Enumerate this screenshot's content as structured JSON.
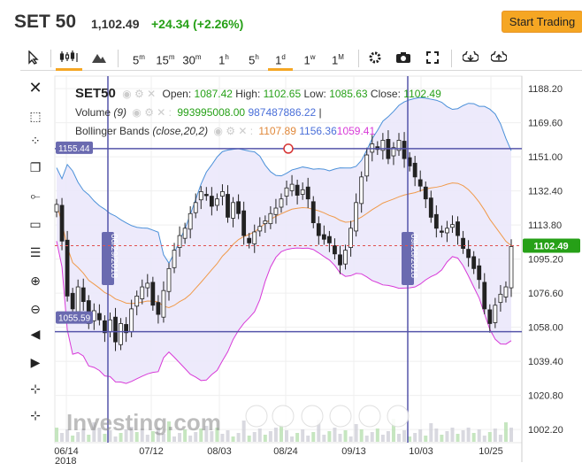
{
  "header": {
    "symbol": "SET 50",
    "price": "1,102.49",
    "change": "+24.34 (+2.26%)",
    "start_trading": "Start Trading"
  },
  "toolbar": {
    "timeframes": [
      "5m",
      "15m",
      "30m",
      "1h",
      "5h",
      "1d",
      "1w",
      "1M"
    ],
    "active_timeframe": "1d",
    "icons": [
      "cursor-icon",
      "candles-icon",
      "mountain-icon",
      "gear-icon",
      "camera-icon",
      "fullscreen-icon",
      "download-icon",
      "upload-icon"
    ]
  },
  "left_tools": [
    "close-icon",
    "zoom-select-icon",
    "crosshair-icon",
    "clone-icon",
    "trendline-icon",
    "rectangle-icon",
    "fib-icon",
    "zoom-in-icon",
    "zoom-out-icon",
    "scroll-left-icon",
    "scroll-right-icon",
    "magnet-plus-icon",
    "magnet-minus-icon"
  ],
  "info": {
    "symbol": "SET50",
    "open_label": "Open:",
    "open": "1087.42",
    "high_label": "High:",
    "high": "1102.65",
    "low_label": "Low:",
    "low": "1085.63",
    "close_label": "Close:",
    "close": "1102.49",
    "volume_label": "Volume",
    "volume_param": "(9)",
    "volume_values": "993995008.00",
    "volume_ma": "987487886.22",
    "bb_label": "Bollinger Bands",
    "bb_params": "(close,20,2)",
    "bb_mid": "1107.89",
    "bb_upper": "1156.36",
    "bb_lower": "1059.41"
  },
  "colors": {
    "up": "#26a017",
    "down": "#d63333",
    "accent": "#f5a623",
    "band_upper": "#4a90d9",
    "band_lower": "#d83ad8",
    "band_mid": "#f09a4a",
    "band_fill": "#ebe8fb",
    "hline": "#5555aa",
    "price_tag": "#26a017"
  },
  "chart_data": {
    "type": "candlestick",
    "price_axis_ticks": [
      "1188.20",
      "1169.60",
      "1151.00",
      "1132.40",
      "1113.80",
      "1095.20",
      "1076.60",
      "1058.00",
      "1039.40",
      "1020.80",
      "1002.20"
    ],
    "ylim": [
      995,
      1195
    ],
    "x_ticks": [
      "06/14",
      "07/12",
      "08/03",
      "08/24",
      "09/13",
      "10/03",
      "10/25"
    ],
    "x_year": "2018",
    "current_price_tag": "1102.49",
    "hline_labels": [
      "1155.44",
      "1055.59"
    ],
    "vline_labels": [
      "06/29/2018",
      "09/28/2018"
    ],
    "watermark": "Investing.com",
    "closes": [
      1125,
      1105,
      1075,
      1068,
      1080,
      1072,
      1060,
      1067,
      1062,
      1055,
      1062,
      1050,
      1060,
      1055,
      1068,
      1075,
      1080,
      1082,
      1070,
      1065,
      1078,
      1090,
      1100,
      1108,
      1112,
      1120,
      1126,
      1132,
      1130,
      1124,
      1128,
      1132,
      1118,
      1126,
      1120,
      1108,
      1104,
      1110,
      1113,
      1116,
      1120,
      1123,
      1128,
      1134,
      1136,
      1130,
      1133,
      1128,
      1115,
      1108,
      1106,
      1104,
      1098,
      1092,
      1100,
      1112,
      1126,
      1140,
      1152,
      1158,
      1155,
      1160,
      1150,
      1156,
      1160,
      1150,
      1146,
      1140,
      1135,
      1128,
      1118,
      1112,
      1110,
      1112,
      1114,
      1108,
      1101,
      1096,
      1090,
      1084,
      1068,
      1060,
      1070,
      1076,
      1080,
      1102
    ],
    "bb_upper_last": 1156.36,
    "bb_mid_last": 1107.89,
    "bb_lower_last": 1059.41
  }
}
